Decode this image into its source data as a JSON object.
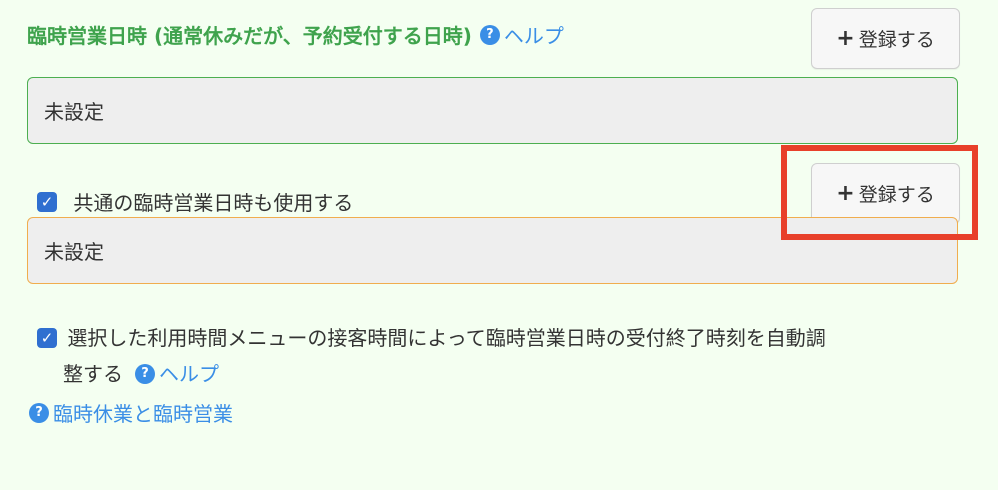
{
  "section": {
    "title": "臨時営業日時 (通常休みだが、予約受付する日時)",
    "help_label": "ヘルプ"
  },
  "register_button_1": {
    "label": "登録する"
  },
  "register_button_2": {
    "label": "登録する"
  },
  "value_box_1": "未設定",
  "value_box_2": "未設定",
  "checkbox_common": {
    "checked": true,
    "label": "共通の臨時営業日時も使用する"
  },
  "checkbox_auto": {
    "checked": true,
    "label_line1": "選択した利用時間メニューの接客時間によって臨時営業日時の受付終了時刻を自動調",
    "label_line2": "整する",
    "help_label": "ヘルプ"
  },
  "footer_link": "臨時休業と臨時営業",
  "colors": {
    "background": "#f4fff1",
    "title_green": "#3fa34d",
    "link_blue": "#3a8ee6",
    "highlight_red": "#e8402a"
  },
  "icons": {
    "help": "question-circle-icon",
    "plus": "plus-icon",
    "checkbox": "check-icon"
  }
}
